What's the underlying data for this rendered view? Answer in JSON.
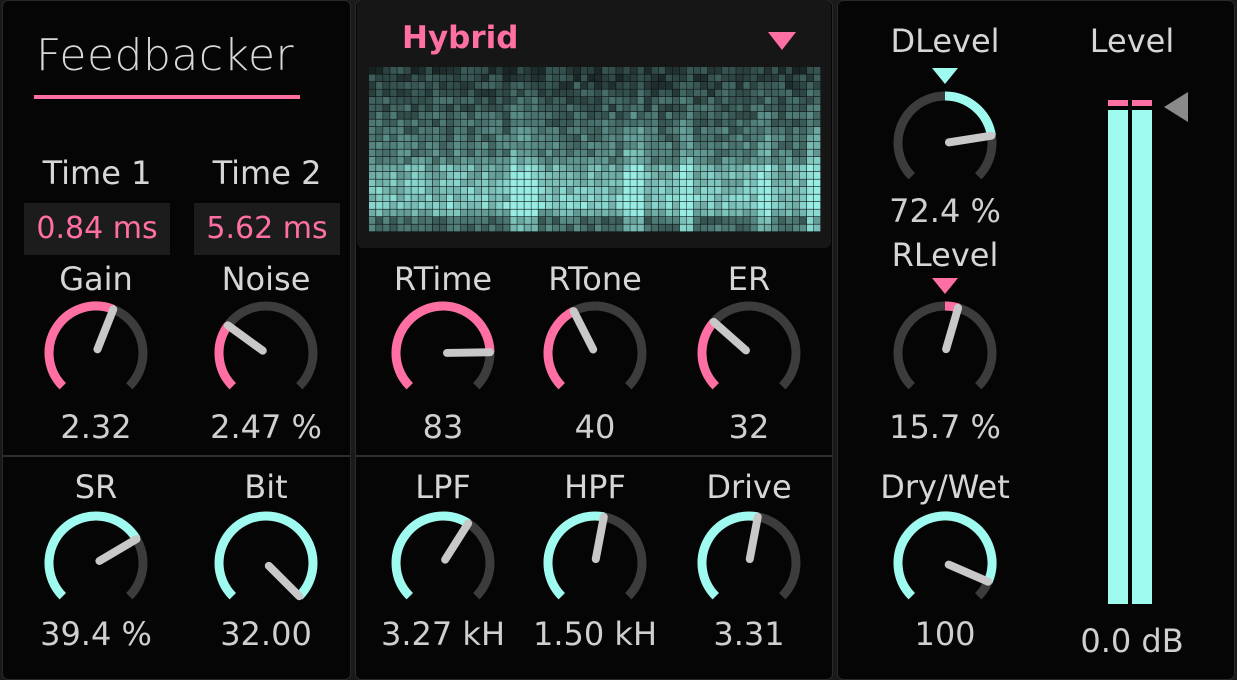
{
  "device": {
    "title": "Feedbacker"
  },
  "colors": {
    "pink": "#ff6fa3",
    "cyan": "#9ffaf0",
    "track": "#3c3c3c",
    "needle": "#c8c8c8"
  },
  "delay": {
    "time1": {
      "label": "Time 1",
      "value": "0.84 ms"
    },
    "time2": {
      "label": "Time 2",
      "value": "5.62 ms"
    }
  },
  "knobs": [
    {
      "id": "gain",
      "label": "Gain",
      "value": "2.32",
      "fraction": 0.58,
      "color": "pink"
    },
    {
      "id": "noise",
      "label": "Noise",
      "value": "2.47 %",
      "fraction": 0.3,
      "color": "pink"
    },
    {
      "id": "sr",
      "label": "SR",
      "value": "39.4 %",
      "fraction": 0.72,
      "color": "cyan"
    },
    {
      "id": "bit",
      "label": "Bit",
      "value": "32.00",
      "fraction": 1.0,
      "color": "cyan"
    },
    {
      "id": "rtime",
      "label": "RTime",
      "value": "83",
      "fraction": 0.83,
      "color": "pink"
    },
    {
      "id": "rtone",
      "label": "RTone",
      "value": "40",
      "fraction": 0.4,
      "color": "pink"
    },
    {
      "id": "er",
      "label": "ER",
      "value": "32",
      "fraction": 0.32,
      "color": "pink"
    },
    {
      "id": "lpf",
      "label": "LPF",
      "value": "3.27 kH",
      "fraction": 0.62,
      "color": "cyan"
    },
    {
      "id": "hpf",
      "label": "HPF",
      "value": "1.50 kH",
      "fraction": 0.54,
      "color": "cyan"
    },
    {
      "id": "drive",
      "label": "Drive",
      "value": "3.31",
      "fraction": 0.54,
      "color": "cyan"
    },
    {
      "id": "dlevel",
      "label": "DLevel",
      "value": "72.4 %",
      "fraction": 0.8,
      "color": "cyan",
      "bipolar": true
    },
    {
      "id": "rlevel",
      "label": "RLevel",
      "value": "15.7 %",
      "fraction": 0.56,
      "color": "pink",
      "bipolar": true
    },
    {
      "id": "drywet",
      "label": "Dry/Wet",
      "value": "100",
      "fraction": 0.92,
      "color": "cyan"
    }
  ],
  "reverb": {
    "preset": "Hybrid"
  },
  "output": {
    "label": "Level",
    "value": "0.0 dB"
  }
}
